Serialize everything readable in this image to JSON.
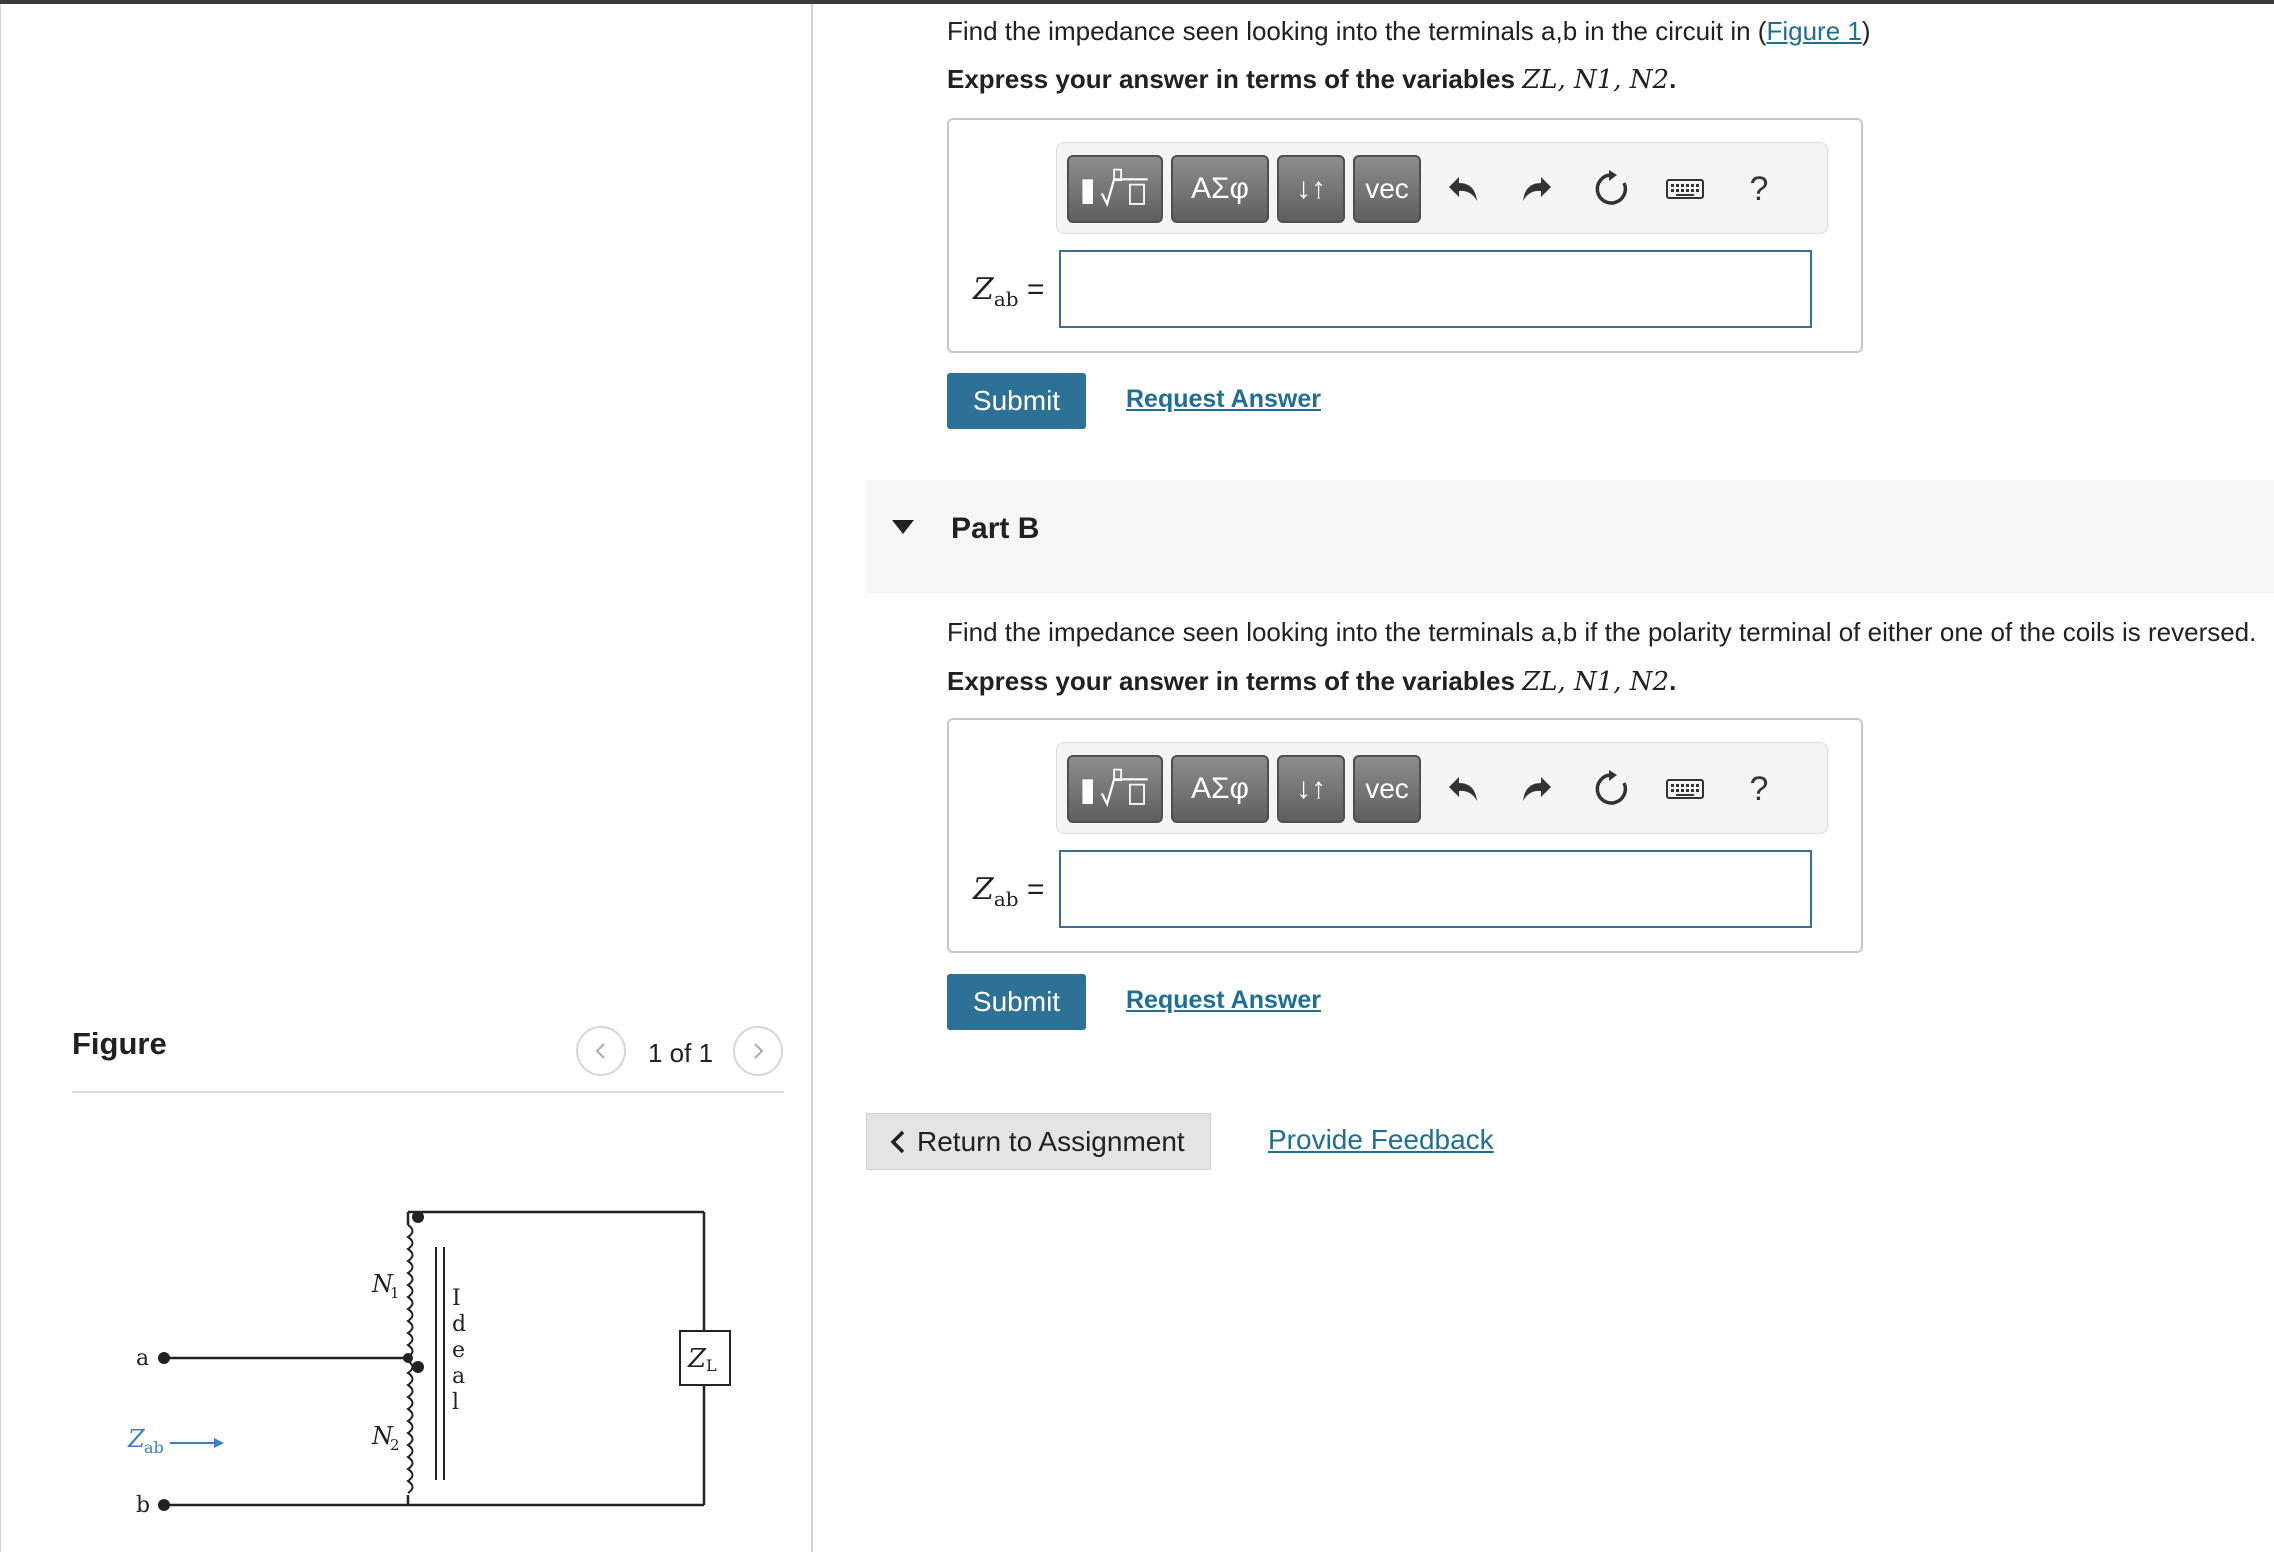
{
  "figure_panel": {
    "title": "Figure",
    "pager": "1 of 1",
    "circuit": {
      "terminal_a": "a",
      "terminal_b": "b",
      "zab_label": "Z",
      "zab_sub": "ab",
      "n1_label": "N",
      "n1_sub": "1",
      "n2_label": "N",
      "n2_sub": "2",
      "core_label": [
        "I",
        "d",
        "e",
        "a",
        "l"
      ],
      "load_label": "Z",
      "load_sub": "L"
    }
  },
  "part_a": {
    "question_prefix": "Find the impedance seen looking into the terminals a,b in the circuit in (",
    "figure_link": "Figure 1",
    "question_suffix": ")",
    "express_prefix": "Express your answer in terms of the variables ",
    "express_vars": "ZL, N1, N2",
    "express_suffix": ".",
    "answer_label_var": "Z",
    "answer_label_sub": "ab",
    "answer_label_eq": " =",
    "answer_value": "",
    "submit_label": "Submit",
    "request_label": "Request Answer"
  },
  "part_b": {
    "title": "Part B",
    "question": "Find the impedance seen looking into the terminals a,b if the polarity terminal of either one of the coils is reversed.",
    "express_prefix": "Express your answer in terms of the variables ",
    "express_vars": "ZL, N1, N2",
    "express_suffix": ".",
    "answer_label_var": "Z",
    "answer_label_sub": "ab",
    "answer_label_eq": " =",
    "answer_value": "",
    "submit_label": "Submit",
    "request_label": "Request Answer"
  },
  "toolbar": {
    "greek_label": "ΑΣφ",
    "arrows_label": "↓↑",
    "vec_label": "vec",
    "help_label": "?"
  },
  "footer": {
    "return_label": "Return to Assignment",
    "feedback_label": "Provide Feedback"
  }
}
